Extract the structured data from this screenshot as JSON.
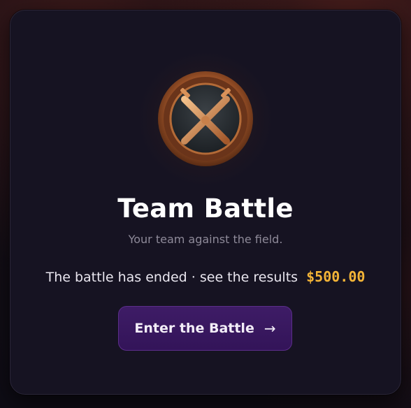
{
  "card": {
    "title": "Team Battle",
    "subtitle": "Your team against the field.",
    "status_text": "The battle has ended · see the results",
    "prize": "$500.00"
  },
  "cta": {
    "label": "Enter the Battle",
    "icon": "arrow-right-icon"
  },
  "emblem": {
    "icon": "crossed-swords-icon"
  },
  "colors": {
    "accent_gold": "#f3b437",
    "button_purple": "#3e1c66",
    "card_bg": "#161322"
  }
}
